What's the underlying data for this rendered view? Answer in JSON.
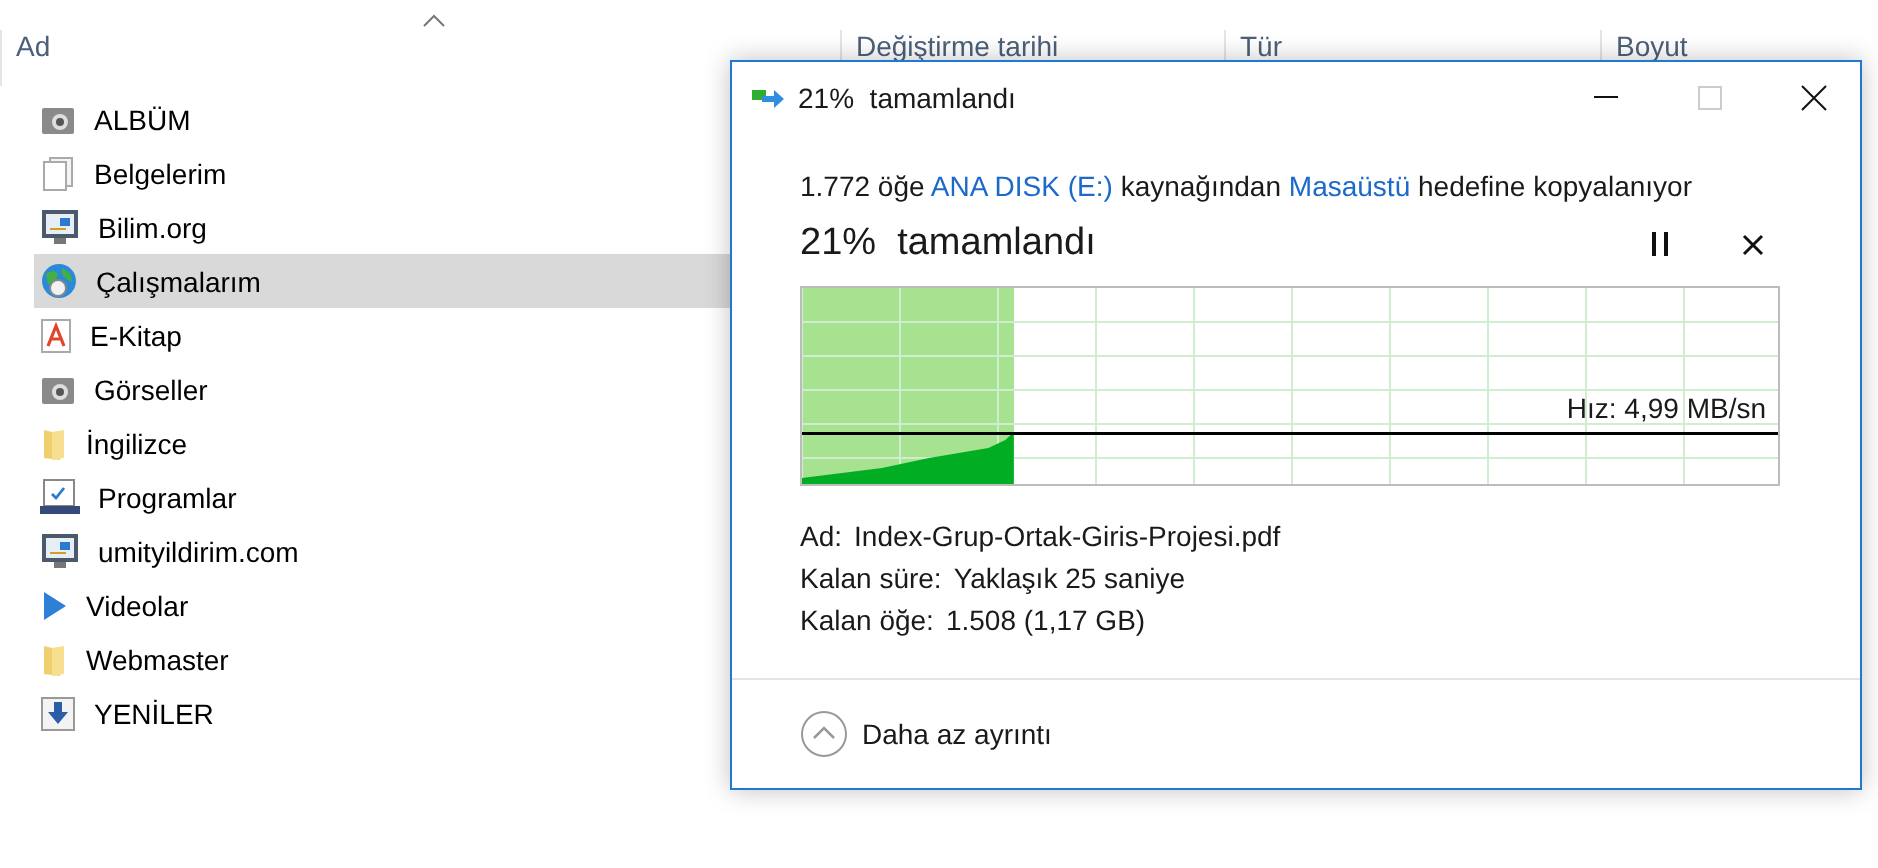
{
  "explorer": {
    "columns": [
      "Ad",
      "Değiştirme tarihi",
      "Tür",
      "Boyut"
    ],
    "items": [
      {
        "name": "ALBÜM",
        "kind": "camera",
        "selected": false
      },
      {
        "name": "Belgelerim",
        "kind": "documents",
        "selected": false
      },
      {
        "name": "Bilim.org",
        "kind": "monitor",
        "selected": false
      },
      {
        "name": "Çalışmalarım",
        "kind": "globe",
        "selected": true
      },
      {
        "name": "E-Kitap",
        "kind": "pdf",
        "selected": false
      },
      {
        "name": "Görseller",
        "kind": "camera",
        "selected": false
      },
      {
        "name": "İngilizce",
        "kind": "folder",
        "selected": false
      },
      {
        "name": "Programlar",
        "kind": "installer",
        "selected": false
      },
      {
        "name": "umityildirim.com",
        "kind": "monitor",
        "selected": false
      },
      {
        "name": "Videolar",
        "kind": "play",
        "selected": false
      },
      {
        "name": "Webmaster",
        "kind": "folder",
        "selected": false
      },
      {
        "name": "YENİLER",
        "kind": "download",
        "selected": false
      }
    ]
  },
  "dialog": {
    "title": "21%  tamamlandı",
    "description": [
      {
        "text": "1.772 öğe ",
        "kind": "plain"
      },
      {
        "text": "ANA DISK (E:)",
        "kind": "link"
      },
      {
        "text": " kaynağından ",
        "kind": "plain"
      },
      {
        "text": "Masaüstü",
        "kind": "link"
      },
      {
        "text": " hedefine kopyalanıyor",
        "kind": "plain"
      }
    ],
    "progress": {
      "label": "21%  tamamlandı",
      "level": 0.217,
      "speed": "Hız: 4,99 MB/sn"
    },
    "details": [
      {
        "label": "Ad:",
        "value": "Index-Grup-Ortak-Giris-Projesi.pdf"
      },
      {
        "label": "Kalan süre:",
        "value": "Yaklaşık 25 saniye"
      },
      {
        "label": "Kalan öğe:",
        "value": "1.508 (1,17 GB)"
      }
    ],
    "toggle": {
      "label": "Daha az ayrıntı",
      "expanded": true
    }
  }
}
